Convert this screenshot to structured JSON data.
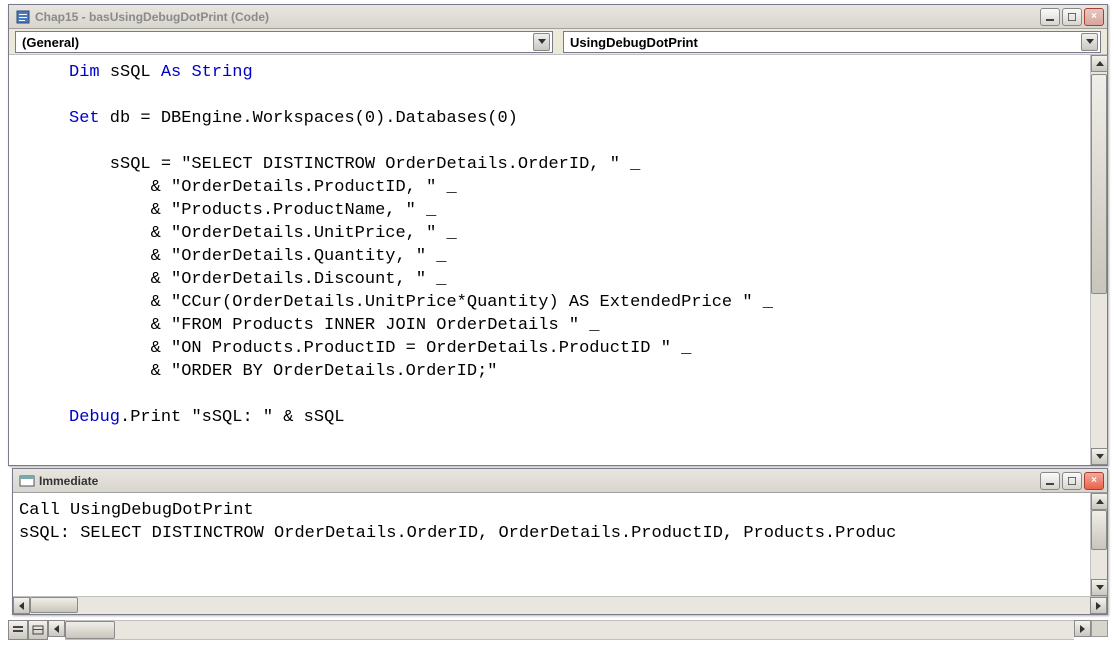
{
  "code_window": {
    "title": "Chap15 - basUsingDebugDotPrint (Code)",
    "object_dropdown": "(General)",
    "proc_dropdown": "UsingDebugDotPrint",
    "code": {
      "kw_dim": "Dim",
      "var_ssql": "sSQL",
      "kw_as": "As",
      "kw_string": "String",
      "kw_set": "Set",
      "l2": " db = DBEngine.Workspaces(0).Databases(0)",
      "s1a": "    sSQL = ",
      "s1b": "\"SELECT DISTINCTROW OrderDetails.OrderID, \"",
      "s1c": " _",
      "s2a": "        & ",
      "s2b": "\"OrderDetails.ProductID, \"",
      "s2c": " _",
      "s3a": "        & ",
      "s3b": "\"Products.ProductName, \"",
      "s3c": " _",
      "s4a": "        & ",
      "s4b": "\"OrderDetails.UnitPrice, \"",
      "s4c": " _",
      "s5a": "        & ",
      "s5b": "\"OrderDetails.Quantity, \"",
      "s5c": " _",
      "s6a": "        & ",
      "s6b": "\"OrderDetails.Discount, \"",
      "s6c": " _",
      "s7a": "        & ",
      "s7b": "\"CCur(OrderDetails.UnitPrice*Quantity) AS ExtendedPrice \"",
      "s7c": " _",
      "s8a": "        & ",
      "s8b": "\"FROM Products INNER JOIN OrderDetails \"",
      "s8c": " _",
      "s9a": "        & ",
      "s9b": "\"ON Products.ProductID = OrderDetails.ProductID \"",
      "s9c": " _",
      "s10a": "        & ",
      "s10b": "\"ORDER BY OrderDetails.OrderID;\"",
      "dbg1": "Debug",
      "dbg2": ".Print ",
      "dbg3": "\"sSQL: \"",
      "dbg4": " & sSQL"
    }
  },
  "immediate": {
    "title": "Immediate",
    "line1": "Call UsingDebugDotPrint",
    "line2": "sSQL: SELECT DISTINCTROW OrderDetails.OrderID, OrderDetails.ProductID, Products.Produc"
  }
}
